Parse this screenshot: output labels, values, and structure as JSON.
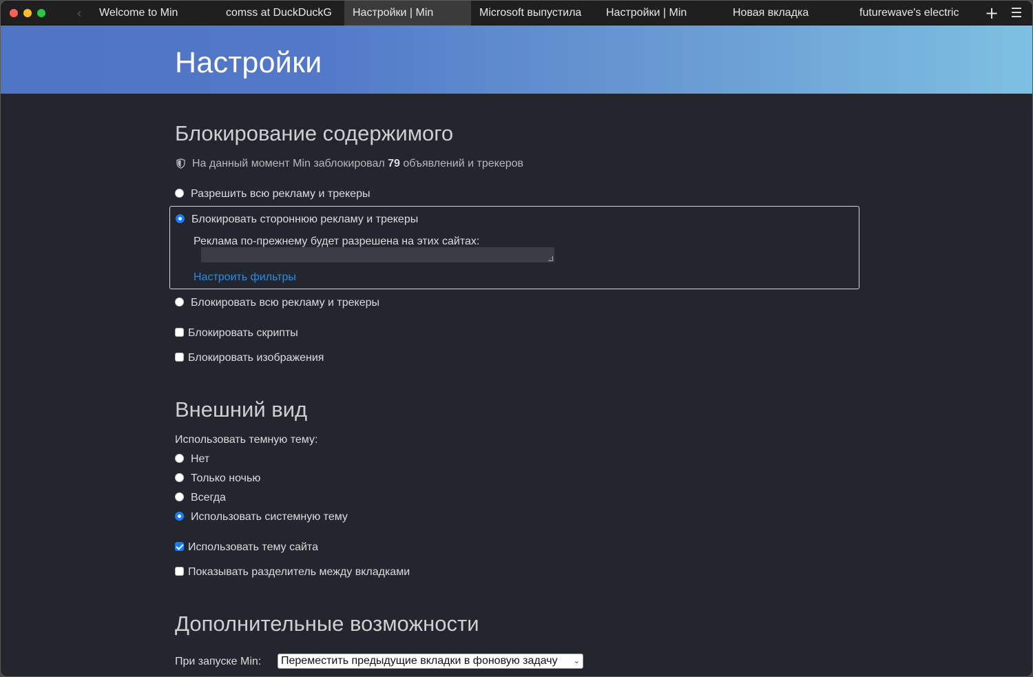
{
  "tabs": [
    {
      "label": "Welcome to Min",
      "active": false
    },
    {
      "label": "comss at DuckDuckG",
      "active": false
    },
    {
      "label": "Настройки | Min",
      "active": true
    },
    {
      "label": "Microsoft выпустила",
      "active": false
    },
    {
      "label": "Настройки | Min",
      "active": false
    },
    {
      "label": "Новая вкладка",
      "active": false
    },
    {
      "label": "futurewave's electric",
      "active": false
    }
  ],
  "toolbar": {
    "back_glyph": "‹",
    "new_tab_glyph": "+",
    "menu_glyph": "☰"
  },
  "page": {
    "title": "Настройки"
  },
  "content_blocking": {
    "title": "Блокирование содержимого",
    "stat_prefix": "На данный момент Min заблокировал",
    "stat_count": "79",
    "stat_suffix": "объявлений и трекеров",
    "options": [
      {
        "label": "Разрешить всю рекламу и трекеры",
        "checked": false
      },
      {
        "label": "Блокировать стороннюю рекламу и трекеры",
        "checked": true
      },
      {
        "label": "Блокировать всю рекламу и трекеры",
        "checked": false
      }
    ],
    "exceptions_label": "Реклама по-прежнему будет разрешена на этих сайтах:",
    "exceptions_value": "",
    "configure_filters_link": "Настроить фильтры",
    "block_scripts_label": "Блокировать скрипты",
    "block_scripts_checked": false,
    "block_images_label": "Блокировать изображения",
    "block_images_checked": false
  },
  "appearance": {
    "title": "Внешний вид",
    "dark_theme_label": "Использовать темную тему:",
    "theme_options": [
      {
        "label": "Нет",
        "checked": false
      },
      {
        "label": "Только ночью",
        "checked": false
      },
      {
        "label": "Всегда",
        "checked": false
      },
      {
        "label": "Использовать системную тему",
        "checked": true
      }
    ],
    "site_theme_label": "Использовать тему сайта",
    "site_theme_checked": true,
    "tab_separator_label": "Показывать разделитель между вкладками",
    "tab_separator_checked": false
  },
  "advanced": {
    "title": "Дополнительные возможности",
    "startup_label": "При запуске Min:",
    "startup_selected": "Переместить предыдущие вкладки в фоновую задачу"
  },
  "colors": {
    "accent": "#1a7cf5",
    "link": "#2d8ce0",
    "background": "#23262e"
  }
}
